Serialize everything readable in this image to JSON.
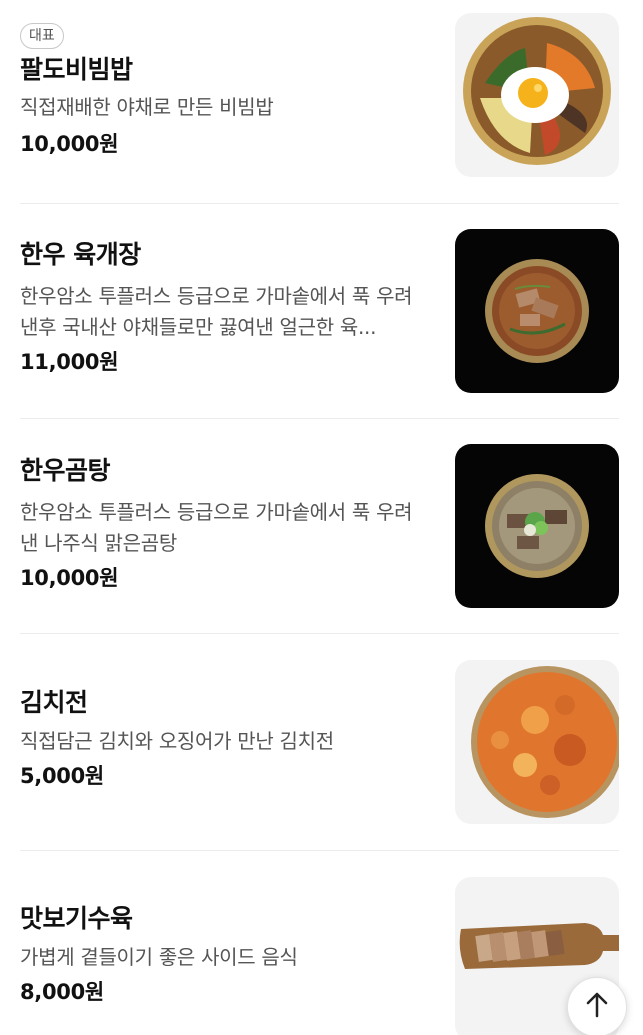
{
  "menu": {
    "items": [
      {
        "badge": "대표",
        "name": "팔도비빔밥",
        "description": "직접재배한 야채로 만든 비빔밥",
        "price": "10,000원",
        "image_icon": "bibimbap-image"
      },
      {
        "name": "한우 육개장",
        "description": "한우암소 투플러스 등급으로 가마솥에서 푹 우려낸후 국내산 야채들로만 끓여낸 얼근한 육...",
        "price": "11,000원",
        "image_icon": "yukgaejang-image"
      },
      {
        "name": "한우곰탕",
        "description": "한우암소 투플러스 등급으로 가마솥에서 푹 우려낸 나주식 맑은곰탕",
        "price": "10,000원",
        "image_icon": "gomtang-image"
      },
      {
        "name": "김치전",
        "description": "직접담근 김치와 오징어가 만난 김치전",
        "price": "5,000원",
        "image_icon": "kimchijeon-image"
      },
      {
        "name": "맛보기수육",
        "description": "가볍게 곁들이기 좋은 사이드 음식",
        "price": "8,000원",
        "image_icon": "suyuk-image"
      }
    ]
  },
  "scroll_top_button": {
    "icon": "arrow-up-icon"
  }
}
